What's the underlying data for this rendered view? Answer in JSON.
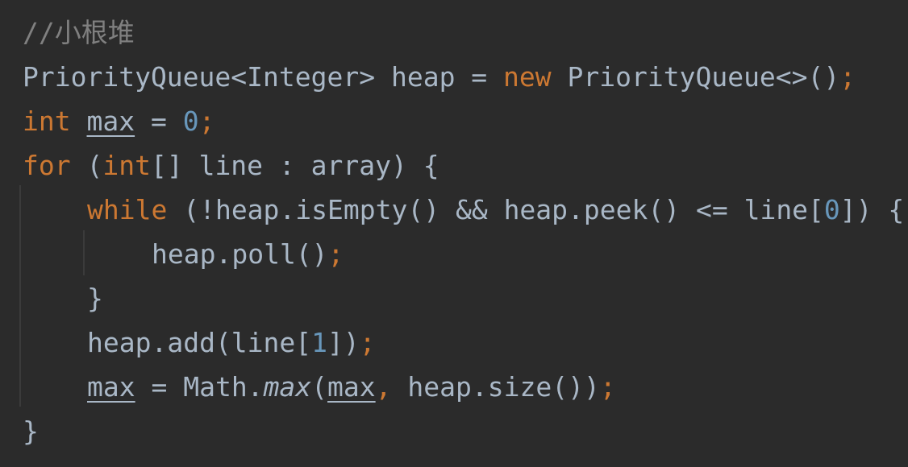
{
  "code": {
    "comment": "//小根堆",
    "line2": {
      "type1": "PriorityQueue<Integer>",
      "var": " heap",
      "assign": " = ",
      "kw_new": "new",
      "type2": " PriorityQueue<>()",
      "semi": ";"
    },
    "line3": {
      "kw_int": "int",
      "space": " ",
      "var": "max",
      "assign": " = ",
      "num": "0",
      "semi": ";"
    },
    "line4": {
      "kw_for": "for",
      "open": " (",
      "kw_int": "int",
      "rest": "[] line : array) {"
    },
    "line5": {
      "kw_while": "while",
      "part1": " (!heap.isEmpty() && heap.peek() <= line[",
      "num": "0",
      "part2": "]) {"
    },
    "line6": {
      "call": "heap.poll()",
      "semi": ";"
    },
    "line7": {
      "brace": "}"
    },
    "line8": {
      "part1": "heap.add(line[",
      "num": "1",
      "part2": "])",
      "semi": ";"
    },
    "line9": {
      "var1": "max",
      "assign": " = Math.",
      "method": "max",
      "open": "(",
      "var2": "max",
      "comma": ",",
      "rest": " heap.size())",
      "semi": ";"
    },
    "line10": {
      "brace": "}"
    }
  },
  "colors": {
    "background": "#2b2b2b",
    "text": "#a9b7c6",
    "keyword": "#cc7832",
    "number": "#6897bb",
    "comment": "#808080"
  }
}
